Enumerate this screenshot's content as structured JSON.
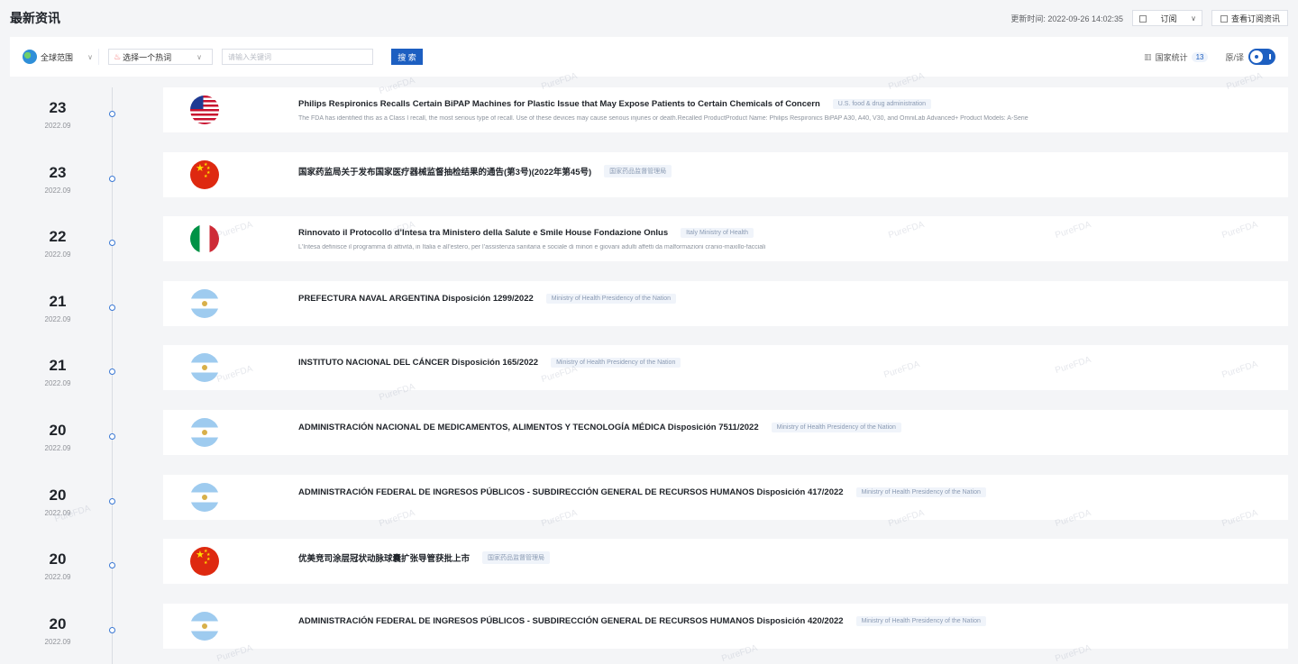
{
  "header": {
    "title": "最新资讯",
    "update_time": "更新时间: 2022-09-26 14:02:35",
    "subscribe_label": "订阅",
    "view_subscription_label": "查看订阅资讯"
  },
  "toolbar": {
    "scope_label": "全球范围",
    "hot_topic_placeholder": "选择一个热词",
    "keyword_placeholder": "请输入关键词",
    "search_label": "搜 索",
    "country_stats_label": "国家统计",
    "country_stats_count": "13",
    "lang_toggle_label": "原/译"
  },
  "watermark_text": "PureFDA",
  "news": [
    {
      "day": "23",
      "month": "2022.09",
      "flag": "us",
      "title": "Philips Respironics Recalls Certain BiPAP Machines for Plastic Issue that May Expose Patients to Certain Chemicals of Concern",
      "source": "U.S. food & drug administration",
      "summary": "The FDA has identified this as a Class I recall, the most serious type of recall. Use of these devices may cause serious injuries or death.Recalled ProductProduct Name: Philips Respironics BiPAP A30, A40, V30, and OmniLab Advanced+ Product Models: A-Serie"
    },
    {
      "day": "23",
      "month": "2022.09",
      "flag": "cn",
      "title": "国家药监局关于发布国家医疗器械监督抽检结果的通告(第3号)(2022年第45号)",
      "source": "国家药品监督管理局",
      "summary": ""
    },
    {
      "day": "22",
      "month": "2022.09",
      "flag": "it",
      "title": "Rinnovato il Protocollo d’Intesa tra Ministero della Salute e Smile House Fondazione Onlus",
      "source": "Italy Ministry of Health",
      "summary": "L'Intesa definisce il programma di attività, in Italia e all’estero, per l’assistenza sanitaria e sociale di minori e giovani adulti affetti da malformazioni cranio-maxillo-facciali"
    },
    {
      "day": "21",
      "month": "2022.09",
      "flag": "ar",
      "title": "PREFECTURA NAVAL ARGENTINA Disposición 1299/2022",
      "source": "Ministry of Health Presidency of the Nation",
      "summary": ""
    },
    {
      "day": "21",
      "month": "2022.09",
      "flag": "ar",
      "title": "INSTITUTO NACIONAL DEL CÁNCER Disposición 165/2022",
      "source": "Ministry of Health Presidency of the Nation",
      "summary": ""
    },
    {
      "day": "20",
      "month": "2022.09",
      "flag": "ar",
      "title": "ADMINISTRACIÓN NACIONAL DE MEDICAMENTOS, ALIMENTOS Y TECNOLOGÍA MÉDICA Disposición 7511/2022",
      "source": "Ministry of Health Presidency of the Nation",
      "summary": ""
    },
    {
      "day": "20",
      "month": "2022.09",
      "flag": "ar",
      "title": "ADMINISTRACIÓN FEDERAL DE INGRESOS PÚBLICOS - SUBDIRECCIÓN GENERAL DE RECURSOS HUMANOS Disposición 417/2022",
      "source": "Ministry of Health Presidency of the Nation",
      "summary": ""
    },
    {
      "day": "20",
      "month": "2022.09",
      "flag": "cn",
      "title": "优美竞司涂层冠状动脉球囊扩张导管获批上市",
      "source": "国家药品监督管理局",
      "summary": ""
    },
    {
      "day": "20",
      "month": "2022.09",
      "flag": "ar",
      "title": "ADMINISTRACIÓN FEDERAL DE INGRESOS PÚBLICOS - SUBDIRECCIÓN GENERAL DE RECURSOS HUMANOS Disposición 420/2022",
      "source": "Ministry of Health Presidency of the Nation",
      "summary": ""
    }
  ]
}
